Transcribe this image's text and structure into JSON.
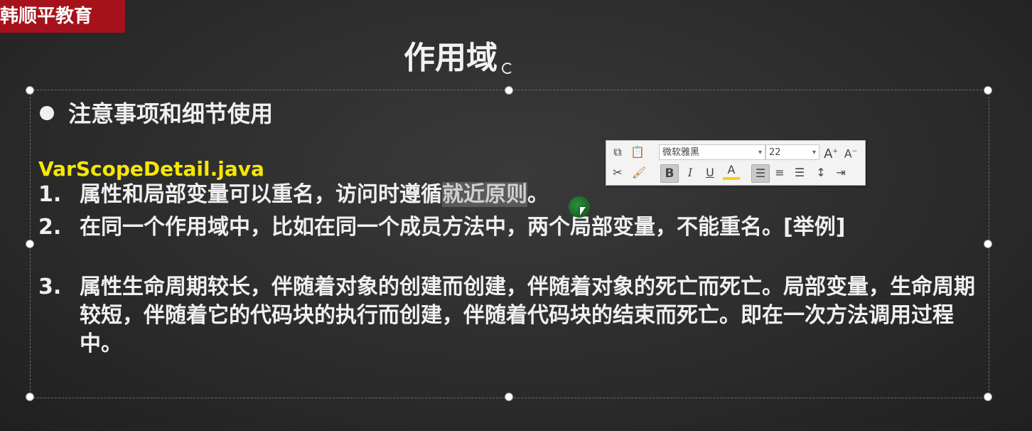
{
  "brand": {
    "logo_text": "韩顺平教育"
  },
  "slide": {
    "title": "作用域",
    "section_heading": "注意事项和细节使用",
    "filename": "VarScopeDetail.java",
    "items": [
      {
        "num": "1.",
        "text_before": "属性和局部变量可以重名，访问时遵循",
        "highlight": "就近原则",
        "text_after": "。"
      },
      {
        "num": "2.",
        "text": "在同一个作用域中，比如在同一个成员方法中，两个局部变量，不能重名。[举例]"
      },
      {
        "num": "3.",
        "text": "属性生命周期较长，伴随着对象的创建而创建，伴随着对象的死亡而死亡。局部变量，生命周期较短，伴随着它的代码块的执行而创建，伴随着代码块的结束而死亡。即在一次方法调用过程中。"
      }
    ]
  },
  "mini_toolbar": {
    "font_name": "微软雅黑",
    "font_size": "22",
    "grow_font": "A",
    "shrink_font": "A",
    "bold": "B",
    "italic": "I",
    "underline": "U",
    "font_color": "A",
    "colors": {
      "text_color_bar": "#ffd000",
      "bold_active_bg": "#c9c9c9"
    }
  },
  "colors": {
    "logo_bg": "#a5121b",
    "filename": "#f5e800",
    "text": "#f0f0f0",
    "background": "#2c2c2c"
  }
}
